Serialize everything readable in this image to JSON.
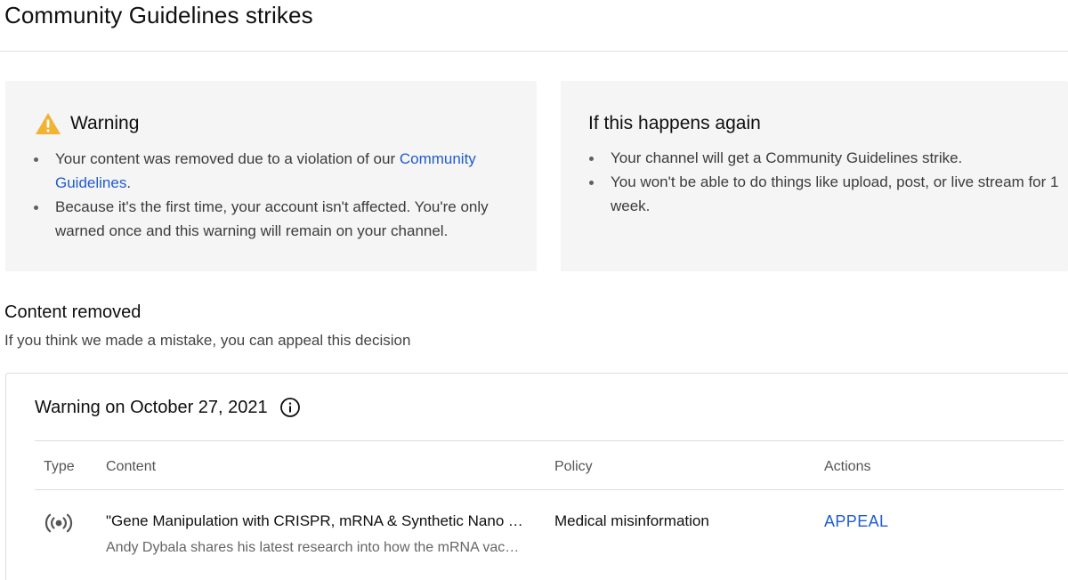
{
  "page": {
    "title": "Community Guidelines strikes"
  },
  "warning_card": {
    "heading": "Warning",
    "icon": "warning-triangle-icon",
    "bullet1_text": "Your content was removed due to a violation of our ",
    "bullet1_link": "Community Guidelines",
    "bullet1_end": ".",
    "bullet2_text": "Because it's the first time, your account isn't affected. You're only warned once and this warning will remain on your channel."
  },
  "again_card": {
    "heading": "If this happens again",
    "bullets": [
      "Your channel will get a Community Guidelines strike.",
      "You won't be able to do things like upload, post, or live stream for 1 week."
    ]
  },
  "content_removed": {
    "title": "Content removed",
    "subtitle": "If you think we made a mistake, you can appeal this decision"
  },
  "strike_panel": {
    "heading": "Warning on October 27, 2021",
    "info_icon": "info-icon",
    "columns": {
      "type": "Type",
      "content": "Content",
      "policy": "Policy",
      "actions": "Actions"
    },
    "row": {
      "type_icon": "live-broadcast-icon",
      "content_title": "\"Gene Manipulation with CRISPR, mRNA & Synthetic Nano T…",
      "content_desc": "Andy Dybala shares his latest research into how the mRNA vac…",
      "policy": "Medical misinformation",
      "action": "APPEAL"
    }
  },
  "colors": {
    "link": "#1f5bd1",
    "card_bg": "#f5f5f5",
    "warning_icon": "#f2b233"
  }
}
